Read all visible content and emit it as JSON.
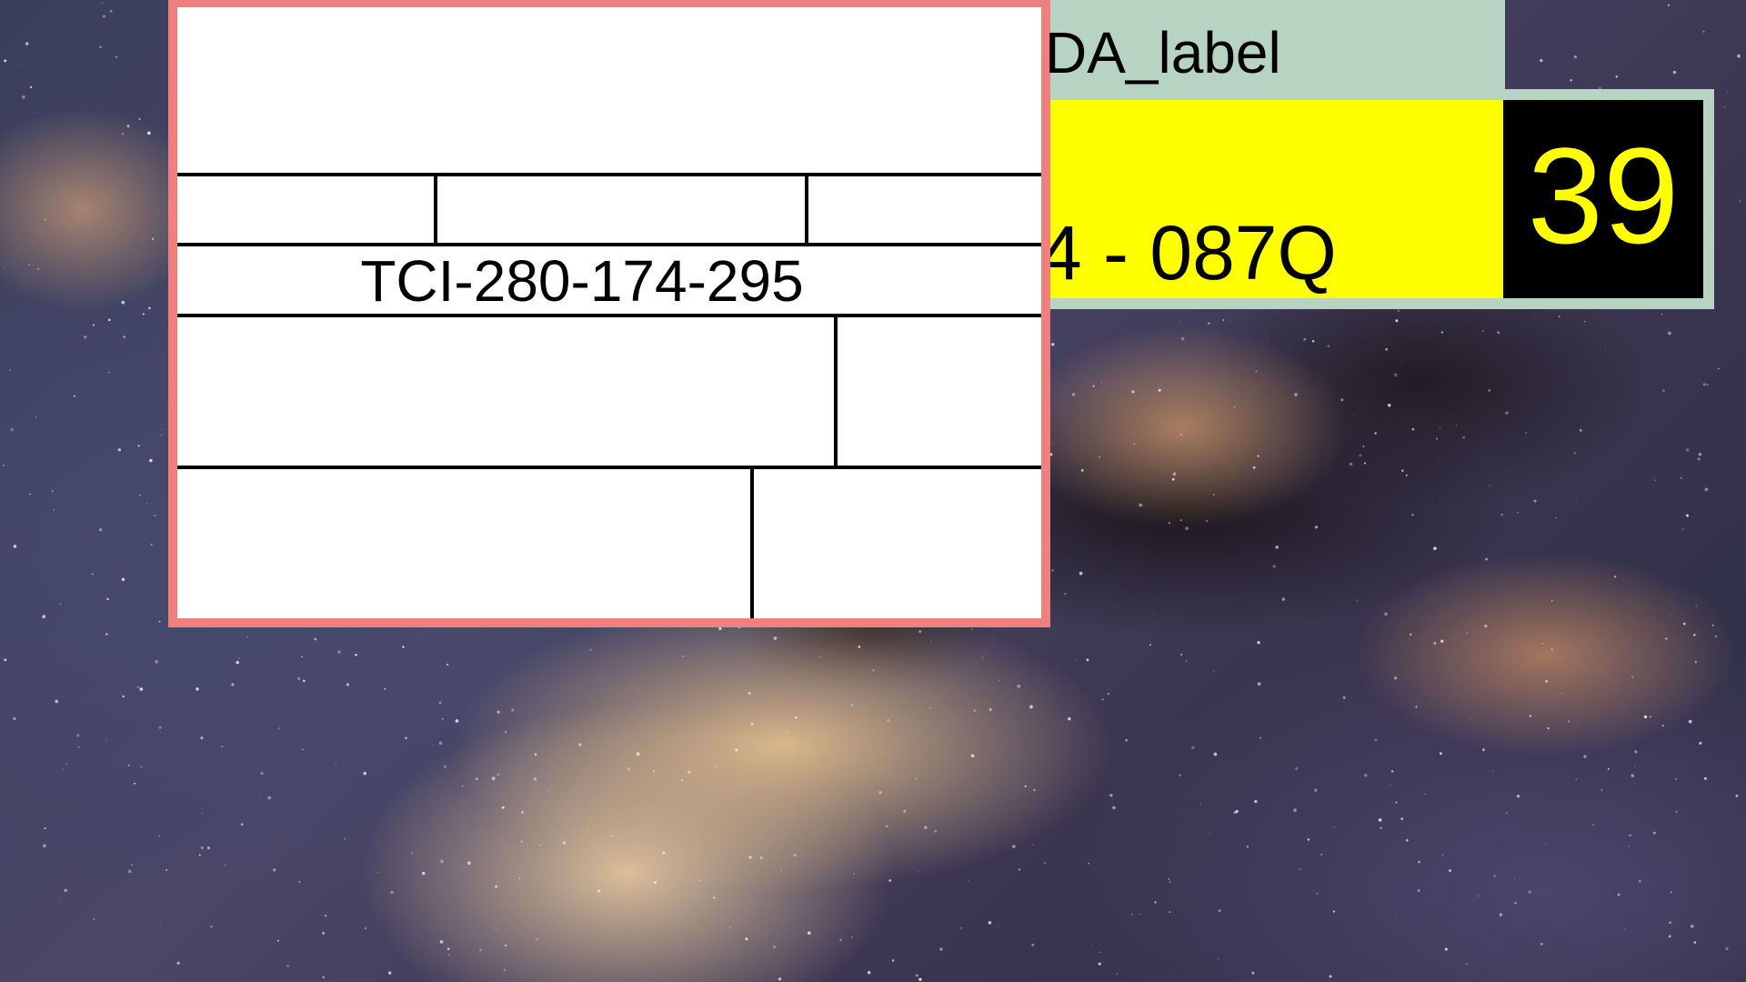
{
  "form": {
    "id_text": "TCI-280-174-295",
    "border_color": "#f08080"
  },
  "label_panel": {
    "text": "DA_label",
    "color": "#b7d3c2"
  },
  "plate": {
    "code": "4 - 087Q",
    "number": "39",
    "background_color": "#ffff00",
    "number_box_color": "#000000",
    "number_color": "#ffff00"
  }
}
